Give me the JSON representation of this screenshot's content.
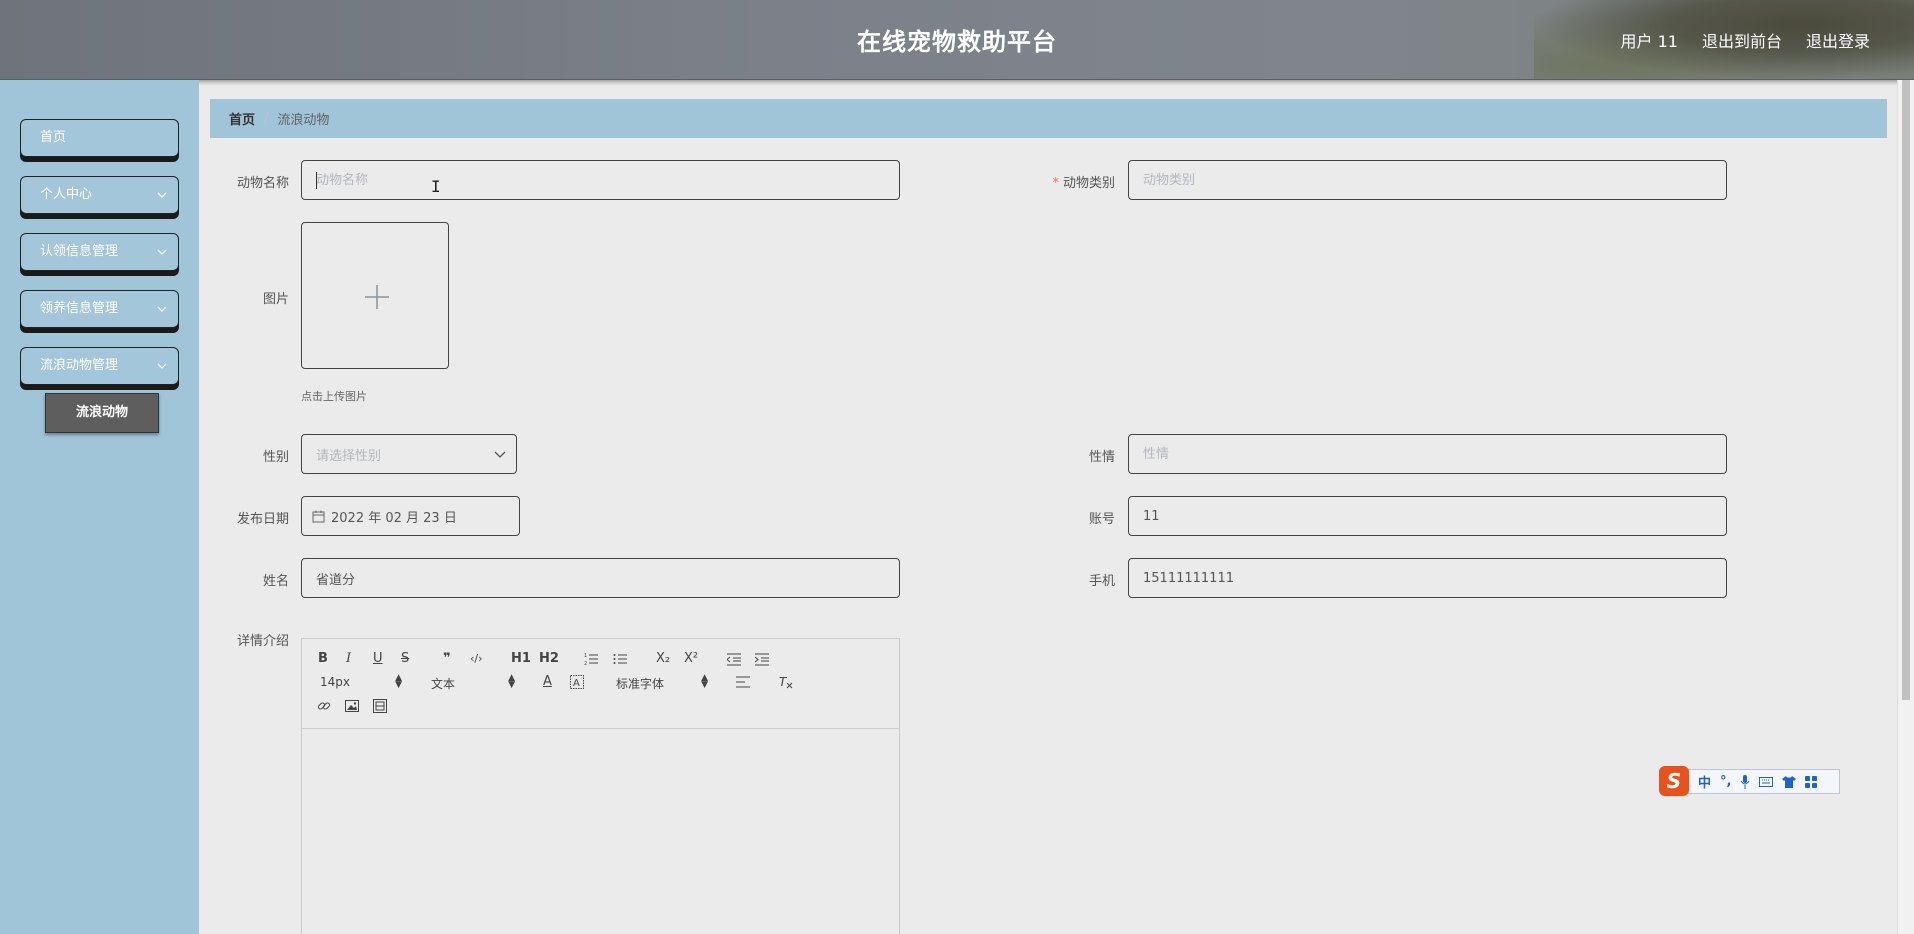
{
  "header": {
    "title": "在线宠物救助平台",
    "user": "用户 11",
    "exit_front": "退出到前台",
    "logout": "退出登录"
  },
  "sidebar": {
    "items": [
      {
        "label": "首页",
        "has_children": false
      },
      {
        "label": "个人中心",
        "has_children": true
      },
      {
        "label": "认领信息管理",
        "has_children": true
      },
      {
        "label": "领养信息管理",
        "has_children": true
      },
      {
        "label": "流浪动物管理",
        "has_children": true
      }
    ],
    "active_sub": "流浪动物"
  },
  "breadcrumb": {
    "home": "首页",
    "separator": "/",
    "current": "流浪动物"
  },
  "form": {
    "name": {
      "label": "动物名称",
      "placeholder": "动物名称",
      "value": ""
    },
    "category": {
      "label": "动物类别",
      "placeholder": "动物类别",
      "value": "",
      "required_mark": "*"
    },
    "image": {
      "label": "图片",
      "hint": "点击上传图片"
    },
    "gender": {
      "label": "性别",
      "placeholder": "请选择性别"
    },
    "temper": {
      "label": "性情",
      "placeholder": "性情",
      "value": ""
    },
    "date": {
      "label": "发布日期",
      "value": "2022 年 02 月 23 日"
    },
    "account": {
      "label": "账号",
      "value": "11"
    },
    "realname": {
      "label": "姓名",
      "value": "省道分"
    },
    "phone": {
      "label": "手机",
      "value": "15111111111"
    },
    "detail": {
      "label": "详情介绍"
    }
  },
  "editor": {
    "font_size": "14px",
    "header_select": "文本",
    "font_family": "标准字体",
    "buttons": [
      "B",
      "I",
      "U",
      "S",
      "❞",
      "‹/›",
      "H1",
      "H2",
      "ordered-list",
      "bullet-list",
      "X₂",
      "X²",
      "outdent",
      "indent",
      "A",
      "background-color",
      "align",
      "clear-format",
      "link",
      "image",
      "video"
    ]
  },
  "ime": {
    "logo": "S",
    "lang": "中",
    "punct": "°,",
    "icons": [
      "mic-icon",
      "keyboard-icon",
      "skin-icon",
      "toolbox-icon"
    ]
  },
  "colors": {
    "sidebar_bg": "#a0c4d8",
    "breadcrumb_bg": "#a0c4d8",
    "content_bg": "#ebebeb",
    "active_sub_bg": "#5e5e5e",
    "required": "#f56c6c"
  }
}
